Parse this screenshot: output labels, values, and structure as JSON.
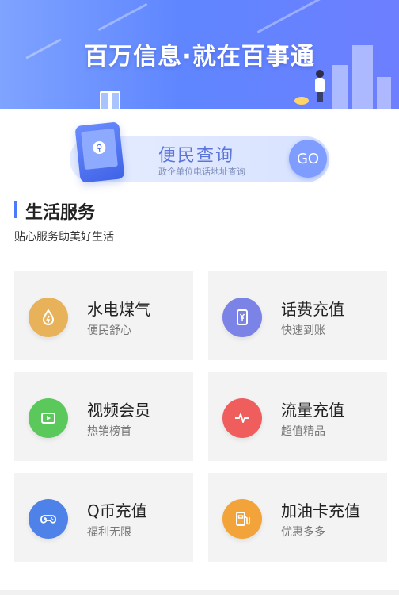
{
  "banner": {
    "title": "百万信息·就在百事通"
  },
  "query": {
    "title": "便民查询",
    "subtitle": "政企单位电话地址查询",
    "go_label": "GO"
  },
  "section": {
    "title": "生活服务",
    "subtitle": "贴心服务助美好生活"
  },
  "services": [
    {
      "title": "水电煤气",
      "subtitle": "便民舒心",
      "icon": "water-drop-icon",
      "color": "#e8b25a"
    },
    {
      "title": "话费充值",
      "subtitle": "快速到账",
      "icon": "phone-yuan-icon",
      "color": "#7b83e6"
    },
    {
      "title": "视频会员",
      "subtitle": "热销榜首",
      "icon": "video-play-icon",
      "color": "#5bc85c"
    },
    {
      "title": "流量充值",
      "subtitle": "超值精品",
      "icon": "pulse-icon",
      "color": "#ef5d5d"
    },
    {
      "title": "Q币充值",
      "subtitle": "福利无限",
      "icon": "gamepad-icon",
      "color": "#4f82e8"
    },
    {
      "title": "加油卡充值",
      "subtitle": "优惠多多",
      "icon": "fuel-pump-icon",
      "color": "#f2a43a"
    }
  ]
}
